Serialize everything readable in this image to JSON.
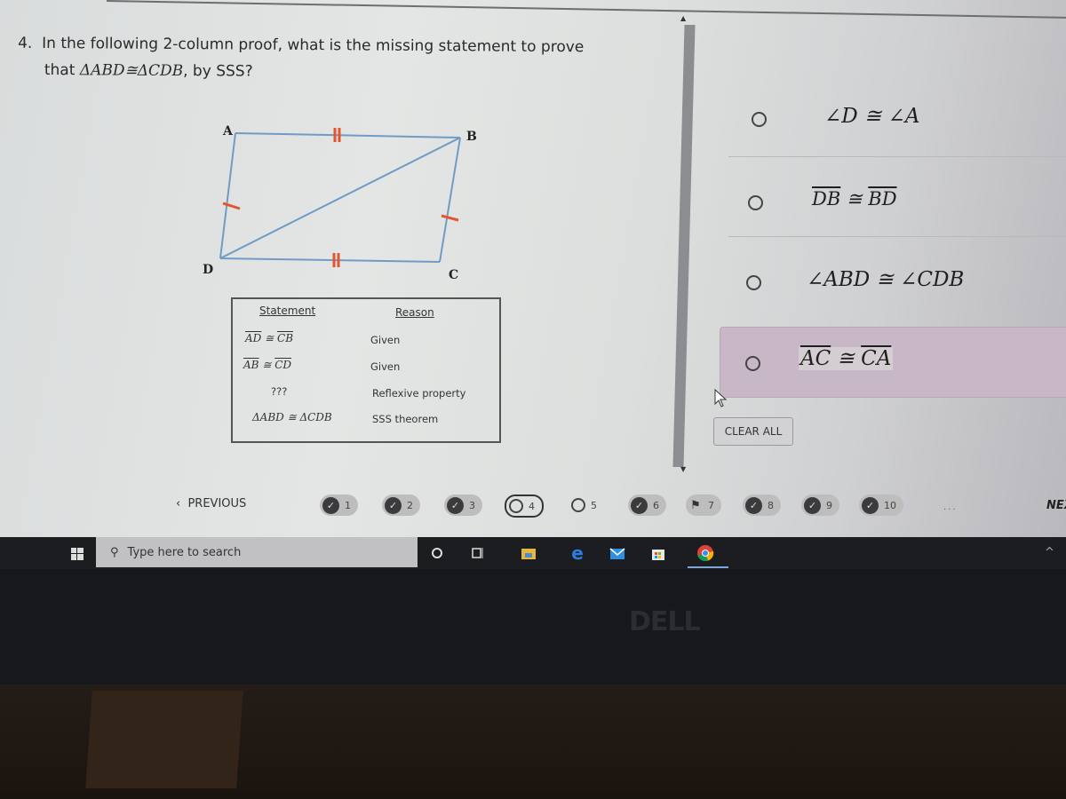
{
  "question": {
    "number": "4.",
    "line1": "In the following 2-column proof, what is the missing statement to prove",
    "line2_prefix": "that",
    "line2_math": "ΔABD≅ΔCDB",
    "line2_suffix": ", by SSS?"
  },
  "figure": {
    "vertices": {
      "A": "A",
      "B": "B",
      "C": "C",
      "D": "D"
    },
    "tick_color": "#e0572f",
    "line_color": "#6f9cc4"
  },
  "proof_table": {
    "headers": {
      "statement": "Statement",
      "reason": "Reason"
    },
    "rows": [
      {
        "statement_left": "AD",
        "rel": "≅",
        "statement_right": "CB",
        "overline": true,
        "reason": "Given"
      },
      {
        "statement_left": "AB",
        "rel": "≅",
        "statement_right": "CD",
        "overline": true,
        "reason": "Given"
      },
      {
        "statement_plain": "???",
        "reason": "Reflexive property"
      },
      {
        "statement_plain": "ΔABD ≅ ΔCDB",
        "reason": "SSS theorem"
      }
    ]
  },
  "options": [
    {
      "text": "∠D ≅ ∠A",
      "selected": false
    },
    {
      "left": "DB",
      "rel": "≅",
      "right": "BD",
      "overline": true,
      "selected": false
    },
    {
      "text": "∠ABD ≅ ∠CDB",
      "selected": false
    },
    {
      "left": "AC",
      "rel": "≅",
      "right": "CA",
      "overline": true,
      "selected": false,
      "hovered": true
    }
  ],
  "clear_all_label": "CLEAR ALL",
  "navigation": {
    "previous_label": "PREVIOUS",
    "next_label": "NEX",
    "ellipsis": "...",
    "questions": [
      {
        "n": "1",
        "status": "answered"
      },
      {
        "n": "2",
        "status": "answered"
      },
      {
        "n": "3",
        "status": "answered"
      },
      {
        "n": "4",
        "status": "current"
      },
      {
        "n": "5",
        "status": "unanswered"
      },
      {
        "n": "6",
        "status": "answered"
      },
      {
        "n": "7",
        "status": "flagged"
      },
      {
        "n": "8",
        "status": "answered"
      },
      {
        "n": "9",
        "status": "answered"
      },
      {
        "n": "10",
        "status": "answered"
      }
    ]
  },
  "taskbar": {
    "search_placeholder": "Type here to search",
    "apps": [
      "cortana-icon",
      "task-view-icon",
      "file-explorer-icon",
      "edge-icon",
      "mail-icon",
      "store-icon",
      "chrome-icon"
    ]
  },
  "bezel_logo": "DELL"
}
